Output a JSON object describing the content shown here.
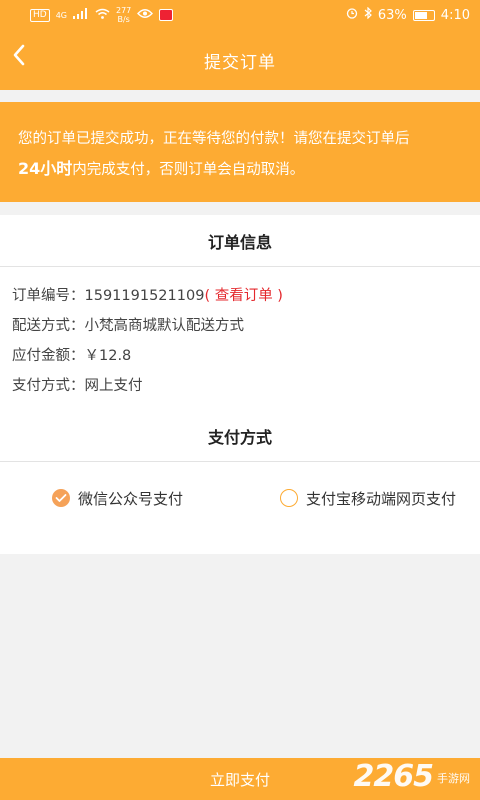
{
  "statusbar": {
    "hd": "HD",
    "network": "4G",
    "speed_value": "277",
    "speed_unit": "B/s",
    "battery": "63%",
    "time": "4:10"
  },
  "header": {
    "title": "提交订单"
  },
  "notice": {
    "line1": "您的订单已提交成功，正在等待您的付款！请您在提交订单后",
    "highlight": "24小时",
    "line2": "内完成支付，否则订单会自动取消。"
  },
  "order_info": {
    "title": "订单信息",
    "order_no_label": "订单编号：",
    "order_no": "1591191521109",
    "view_order": "( 查看订单 )",
    "delivery_label": "配送方式：",
    "delivery": "小梵高商城默认配送方式",
    "amount_label": "应付金额：",
    "amount": "￥12.8",
    "pay_method_label": "支付方式：",
    "pay_method": "网上支付"
  },
  "payment": {
    "title": "支付方式",
    "options": [
      {
        "label": "微信公众号支付",
        "selected": true
      },
      {
        "label": "支付宝移动端网页支付",
        "selected": false
      }
    ]
  },
  "footer": {
    "pay_button": "立即支付"
  },
  "watermark": {
    "number": "2265",
    "site": "手游网"
  },
  "colors": {
    "accent": "#fdab33",
    "link": "#e4282d",
    "radio_checked": "#f5a259"
  }
}
